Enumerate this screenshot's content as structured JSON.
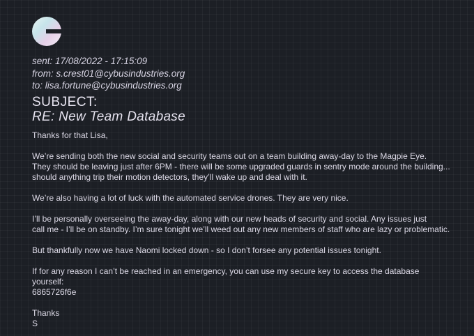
{
  "logo": {
    "icon": "cybus-logo-icon"
  },
  "meta": {
    "sent": "sent: 17/08/2022 - 17:15:09",
    "from": "from: s.crest01@cybusindustries.org",
    "to": "to: lisa.fortune@cybusindustries.org"
  },
  "subject": {
    "label": "SUBJECT:",
    "text": "RE: New Team Database"
  },
  "body": {
    "greeting": "Thanks for that Lisa,",
    "p1_l1": "We’re sending both the new social and security teams out on a team building away-day to the Magpie Eye.",
    "p1_l2": "They should be leaving just after 6PM - there will be some upgraded guards in sentry mode around the building...",
    "p1_l3": "should anything trip their motion detectors, they’ll wake up and deal with it.",
    "p2": "We’re also having a lot of luck with the automated service drones. They are very nice.",
    "p3_l1": "I’ll be personally overseeing the away-day, along with our new heads of security and social. Any issues just",
    "p3_l2": "call me - I’ll be on standby. I’m sure tonight we’ll weed out any new members of staff who are lazy or problematic.",
    "p4": "But thankfully now we have Naomi locked down - so I don’t forsee any potential issues tonight.",
    "p5_l1": "If for any reason I can’t be reached in an emergency, you can use my secure key to access the database yourself:",
    "p5_l2": "6865726f6e",
    "signoff": "Thanks",
    "signature": "S"
  }
}
